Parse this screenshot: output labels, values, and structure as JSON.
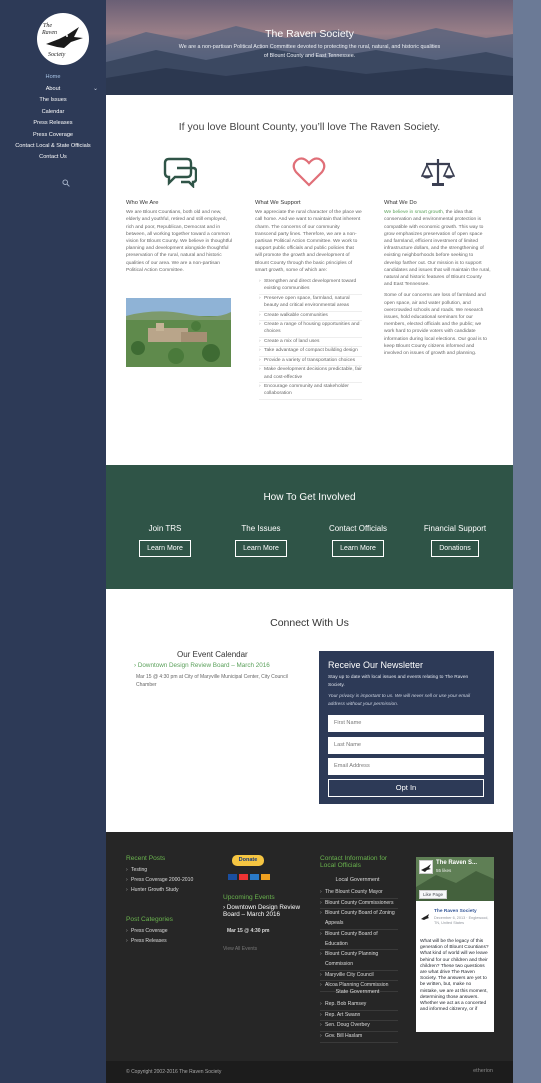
{
  "site": {
    "logo_text": "The Raven Society"
  },
  "nav": {
    "items": [
      {
        "label": "Home",
        "active": true
      },
      {
        "label": "About",
        "has_dropdown": true
      },
      {
        "label": "The Issues"
      },
      {
        "label": "Calendar"
      },
      {
        "label": "Press Releases"
      },
      {
        "label": "Press Coverage"
      },
      {
        "label": "Contact Local & State Officials"
      },
      {
        "label": "Contact Us"
      }
    ],
    "search_icon": "search-icon"
  },
  "hero": {
    "title": "The Raven Society",
    "subtitle": "We are a non-partisan Political Action Committee devoted to protecting the rural, natural, and historic qualities of Blount County and East Tennessee."
  },
  "intro": {
    "heading": "If you love Blount County, you’ll love The Raven Society."
  },
  "columns": {
    "who": {
      "icon": "speech-bubbles-icon",
      "title": "Who We Are",
      "p1": "We are Blount Countians, both old and new, elderly and youthful, retired and still employed, rich and poor, Republican, Democrat and in between, all working together toward a common vision for Blount County. We believe in thoughtful planning and development alongside thoughtful preservation of the rural, natural and historic qualities of our area. We are a non-partisan Political Action Committee."
    },
    "support": {
      "icon": "heart-icon",
      "title": "What We Support",
      "p1": "We appreciate the rural character of the place we call home. And we want to maintain that inherent charm. The concerns of our community transcend party lines. Therefore, we are a non-partisan Political Action Committee. We work to support public officials and public policies that will promote the growth and development of Blount County through the basic principles of smart growth, some of which are:",
      "list": [
        "Strengthen and direct development toward existing communities",
        "Preserve open space, farmland, natural beauty and critical environmental areas",
        "Create walkable communities",
        "Create a range of housing opportunities and choices",
        "Create a mix of land uses",
        "Take advantage of compact building design",
        "Provide a variety of transportation choices",
        "Make development decisions predictable, fair and cost-effective",
        "Encourage community and stakeholder collaboration"
      ]
    },
    "do": {
      "icon": "scales-icon",
      "title": "What We Do",
      "link": "We believe in smart growth,",
      "p1_rest": " the idea that conservation and environmental protection is compatible with economic growth. This way to grow emphasizes preservation of open space and farmland, efficient investment of limited infrastructure dollars, and the strengthening of existing neighborhoods before seeking to develop farther out. Our mission is to support candidates and issues that will maintain the rural, natural and historic features of Blount County and East Tennessee.",
      "p2": "Some of our concerns are loss of farmland and open space, air and water pollution, and overcrowded schools and roads. We research issues, hold educational seminars for our members, elected officials and the public; we work hard to provide voters with candidate information during local elections. Our goal is to keep Blount County citizens informed and involved on issues of growth and planning."
    }
  },
  "involve": {
    "title": "How To Get Involved",
    "items": [
      {
        "label": "Join TRS",
        "button": "Learn More"
      },
      {
        "label": "The Issues",
        "button": "Learn More"
      },
      {
        "label": "Contact Officials",
        "button": "Learn More"
      },
      {
        "label": "Financial Support",
        "button": "Donations"
      }
    ]
  },
  "connect": {
    "title": "Connect With Us",
    "calendar": {
      "title": "Our Event Calendar",
      "event": "Downtown Design Review Board – March 2016",
      "meta": "Mar 15 @ 4:30 pm at City of Maryville Municipal Center, City Council Chamber"
    },
    "newsletter": {
      "title": "Receive Our Newsletter",
      "sub": "Stay up to date with local issues and events relating to The Raven Society.",
      "privacy": "Your privacy is important to us. We will never sell or use your email address without your permission.",
      "first": "First Name",
      "last": "Last Name",
      "email": "Email Address",
      "button": "Opt In"
    }
  },
  "footer": {
    "recent_posts_title": "Recent Posts",
    "recent_posts": [
      "Testing",
      "Press Coverage 2000-2010",
      "Hunter Growth Study"
    ],
    "categories_title": "Post Categories",
    "categories": [
      "Press Coverage",
      "Press Releases"
    ],
    "donate": "Donate",
    "upcoming_title": "Upcoming Events",
    "upcoming_event": "Downtown Design Review Board – March 2016",
    "upcoming_time": "Mar 15 @ 4:30 pm",
    "view_all": "View All Events",
    "contact_title": "Contact Information for Local Officials",
    "local_gov": "Local Government",
    "local_list": [
      "The Blount County Mayor",
      "Blount County Commissioners",
      "Blount County Board of Zoning Appeals",
      "Blount County Board of Education",
      "Blount County Planning Commission",
      "Maryville City Council",
      "Alcoa Planning Commission"
    ],
    "state_gov": "State Government",
    "state_list": [
      "Rep. Bob Ramsey",
      "Rep. Art Swann",
      "Sen. Doug Overbey",
      "Gov. Bill Haslam"
    ],
    "fb_name": "The Raven S...",
    "fb_likes": "55 likes",
    "fb_like_btn": "Like Page",
    "fb_post_name": "The Raven Society",
    "fb_post_meta": "December 6, 2013 · Englewood, TN, United States",
    "fb_post_text": "What will be the legacy of this generation of Blount Countians? What kind of world will we leave behind for our children and their children? These two questions are what drive The Raven Society. The answers are yet to be written, but, make no mistake, we are at this moment, determining those answers. Whether we act as a concerted and informed citizenry, or if",
    "copyright": "© Copyright 2002-2016 The Raven Society",
    "credit": "etherion"
  }
}
